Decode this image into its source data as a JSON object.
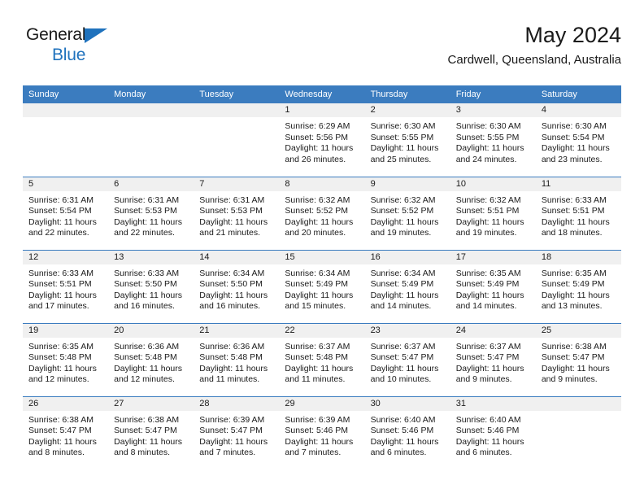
{
  "brand": {
    "name_top": "General",
    "name_bottom": "Blue",
    "color_primary": "#1f72bd"
  },
  "header": {
    "title": "May 2024",
    "subtitle": "Cardwell, Queensland, Australia"
  },
  "theme": {
    "header_bg": "#3b7cbf",
    "daystrip_bg": "#f0f0f0",
    "text": "#1a1a1a",
    "page_bg": "#ffffff"
  },
  "weekdays": [
    "Sunday",
    "Monday",
    "Tuesday",
    "Wednesday",
    "Thursday",
    "Friday",
    "Saturday"
  ],
  "labels": {
    "sunrise_prefix": "Sunrise:",
    "sunset_prefix": "Sunset:",
    "daylight_prefix": "Daylight:"
  },
  "weeks": [
    [
      {
        "day": ""
      },
      {
        "day": ""
      },
      {
        "day": ""
      },
      {
        "day": "1",
        "sunrise": "Sunrise: 6:29 AM",
        "sunset": "Sunset: 5:56 PM",
        "daylight": "Daylight: 11 hours and 26 minutes."
      },
      {
        "day": "2",
        "sunrise": "Sunrise: 6:30 AM",
        "sunset": "Sunset: 5:55 PM",
        "daylight": "Daylight: 11 hours and 25 minutes."
      },
      {
        "day": "3",
        "sunrise": "Sunrise: 6:30 AM",
        "sunset": "Sunset: 5:55 PM",
        "daylight": "Daylight: 11 hours and 24 minutes."
      },
      {
        "day": "4",
        "sunrise": "Sunrise: 6:30 AM",
        "sunset": "Sunset: 5:54 PM",
        "daylight": "Daylight: 11 hours and 23 minutes."
      }
    ],
    [
      {
        "day": "5",
        "sunrise": "Sunrise: 6:31 AM",
        "sunset": "Sunset: 5:54 PM",
        "daylight": "Daylight: 11 hours and 22 minutes."
      },
      {
        "day": "6",
        "sunrise": "Sunrise: 6:31 AM",
        "sunset": "Sunset: 5:53 PM",
        "daylight": "Daylight: 11 hours and 22 minutes."
      },
      {
        "day": "7",
        "sunrise": "Sunrise: 6:31 AM",
        "sunset": "Sunset: 5:53 PM",
        "daylight": "Daylight: 11 hours and 21 minutes."
      },
      {
        "day": "8",
        "sunrise": "Sunrise: 6:32 AM",
        "sunset": "Sunset: 5:52 PM",
        "daylight": "Daylight: 11 hours and 20 minutes."
      },
      {
        "day": "9",
        "sunrise": "Sunrise: 6:32 AM",
        "sunset": "Sunset: 5:52 PM",
        "daylight": "Daylight: 11 hours and 19 minutes."
      },
      {
        "day": "10",
        "sunrise": "Sunrise: 6:32 AM",
        "sunset": "Sunset: 5:51 PM",
        "daylight": "Daylight: 11 hours and 19 minutes."
      },
      {
        "day": "11",
        "sunrise": "Sunrise: 6:33 AM",
        "sunset": "Sunset: 5:51 PM",
        "daylight": "Daylight: 11 hours and 18 minutes."
      }
    ],
    [
      {
        "day": "12",
        "sunrise": "Sunrise: 6:33 AM",
        "sunset": "Sunset: 5:51 PM",
        "daylight": "Daylight: 11 hours and 17 minutes."
      },
      {
        "day": "13",
        "sunrise": "Sunrise: 6:33 AM",
        "sunset": "Sunset: 5:50 PM",
        "daylight": "Daylight: 11 hours and 16 minutes."
      },
      {
        "day": "14",
        "sunrise": "Sunrise: 6:34 AM",
        "sunset": "Sunset: 5:50 PM",
        "daylight": "Daylight: 11 hours and 16 minutes."
      },
      {
        "day": "15",
        "sunrise": "Sunrise: 6:34 AM",
        "sunset": "Sunset: 5:49 PM",
        "daylight": "Daylight: 11 hours and 15 minutes."
      },
      {
        "day": "16",
        "sunrise": "Sunrise: 6:34 AM",
        "sunset": "Sunset: 5:49 PM",
        "daylight": "Daylight: 11 hours and 14 minutes."
      },
      {
        "day": "17",
        "sunrise": "Sunrise: 6:35 AM",
        "sunset": "Sunset: 5:49 PM",
        "daylight": "Daylight: 11 hours and 14 minutes."
      },
      {
        "day": "18",
        "sunrise": "Sunrise: 6:35 AM",
        "sunset": "Sunset: 5:49 PM",
        "daylight": "Daylight: 11 hours and 13 minutes."
      }
    ],
    [
      {
        "day": "19",
        "sunrise": "Sunrise: 6:35 AM",
        "sunset": "Sunset: 5:48 PM",
        "daylight": "Daylight: 11 hours and 12 minutes."
      },
      {
        "day": "20",
        "sunrise": "Sunrise: 6:36 AM",
        "sunset": "Sunset: 5:48 PM",
        "daylight": "Daylight: 11 hours and 12 minutes."
      },
      {
        "day": "21",
        "sunrise": "Sunrise: 6:36 AM",
        "sunset": "Sunset: 5:48 PM",
        "daylight": "Daylight: 11 hours and 11 minutes."
      },
      {
        "day": "22",
        "sunrise": "Sunrise: 6:37 AM",
        "sunset": "Sunset: 5:48 PM",
        "daylight": "Daylight: 11 hours and 11 minutes."
      },
      {
        "day": "23",
        "sunrise": "Sunrise: 6:37 AM",
        "sunset": "Sunset: 5:47 PM",
        "daylight": "Daylight: 11 hours and 10 minutes."
      },
      {
        "day": "24",
        "sunrise": "Sunrise: 6:37 AM",
        "sunset": "Sunset: 5:47 PM",
        "daylight": "Daylight: 11 hours and 9 minutes."
      },
      {
        "day": "25",
        "sunrise": "Sunrise: 6:38 AM",
        "sunset": "Sunset: 5:47 PM",
        "daylight": "Daylight: 11 hours and 9 minutes."
      }
    ],
    [
      {
        "day": "26",
        "sunrise": "Sunrise: 6:38 AM",
        "sunset": "Sunset: 5:47 PM",
        "daylight": "Daylight: 11 hours and 8 minutes."
      },
      {
        "day": "27",
        "sunrise": "Sunrise: 6:38 AM",
        "sunset": "Sunset: 5:47 PM",
        "daylight": "Daylight: 11 hours and 8 minutes."
      },
      {
        "day": "28",
        "sunrise": "Sunrise: 6:39 AM",
        "sunset": "Sunset: 5:47 PM",
        "daylight": "Daylight: 11 hours and 7 minutes."
      },
      {
        "day": "29",
        "sunrise": "Sunrise: 6:39 AM",
        "sunset": "Sunset: 5:46 PM",
        "daylight": "Daylight: 11 hours and 7 minutes."
      },
      {
        "day": "30",
        "sunrise": "Sunrise: 6:40 AM",
        "sunset": "Sunset: 5:46 PM",
        "daylight": "Daylight: 11 hours and 6 minutes."
      },
      {
        "day": "31",
        "sunrise": "Sunrise: 6:40 AM",
        "sunset": "Sunset: 5:46 PM",
        "daylight": "Daylight: 11 hours and 6 minutes."
      },
      {
        "day": ""
      }
    ]
  ]
}
